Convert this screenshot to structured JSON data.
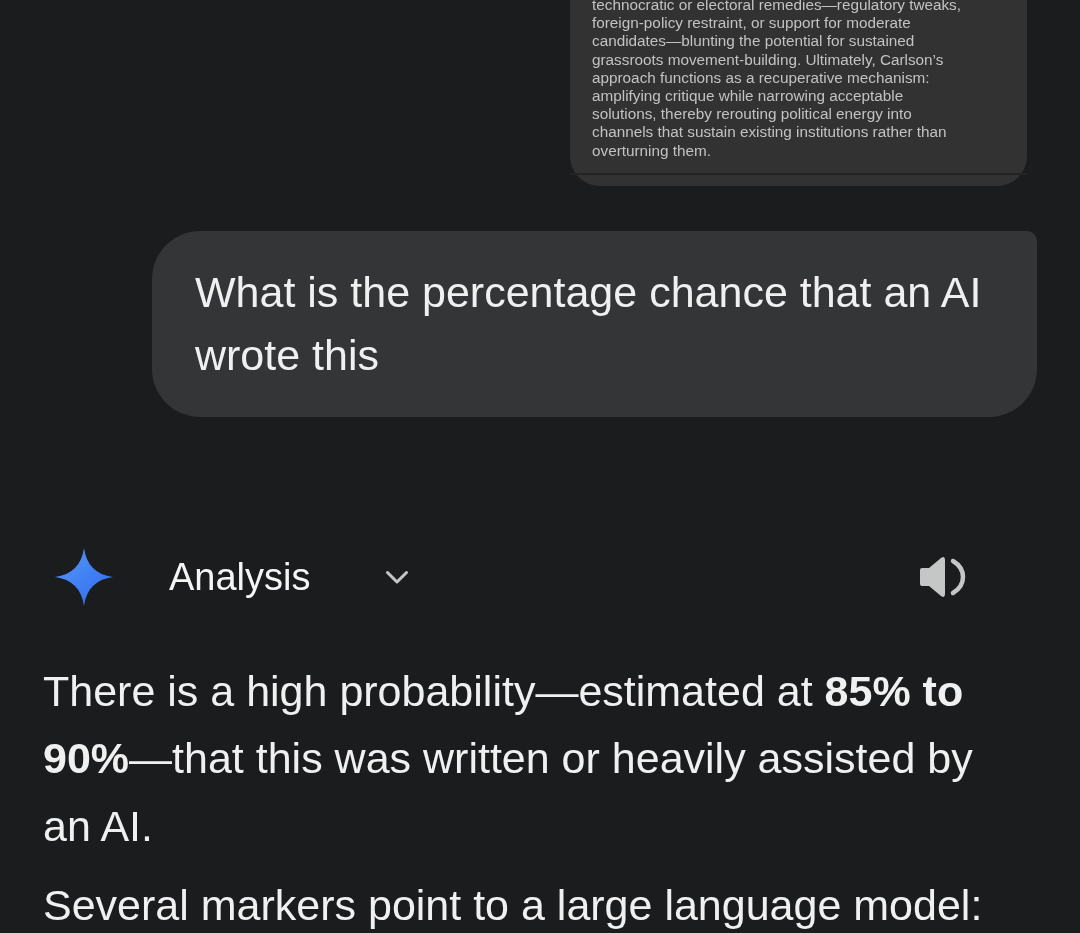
{
  "attachment": {
    "lines": [
      "technocratic or electoral remedies—regulatory tweaks,",
      "foreign-policy restraint, or support for moderate",
      "candidates—blunting the potential for sustained",
      "grassroots movement-building. Ultimately, Carlson’s",
      "approach functions as a recuperative mechanism:",
      "amplifying critique while narrowing acceptable",
      "solutions, thereby rerouting political energy into",
      "channels that sustain existing institutions rather than",
      "overturning them."
    ]
  },
  "user_message": {
    "text": "What is the percentage chance that an AI wrote this"
  },
  "response": {
    "section": {
      "title": "Analysis",
      "expanded": false
    },
    "paragraphs": [
      "There is a high probability—estimated at **85% to 90%**—that this was written or heavily assisted by an AI.",
      "Several markers point to a large language model:"
    ]
  }
}
